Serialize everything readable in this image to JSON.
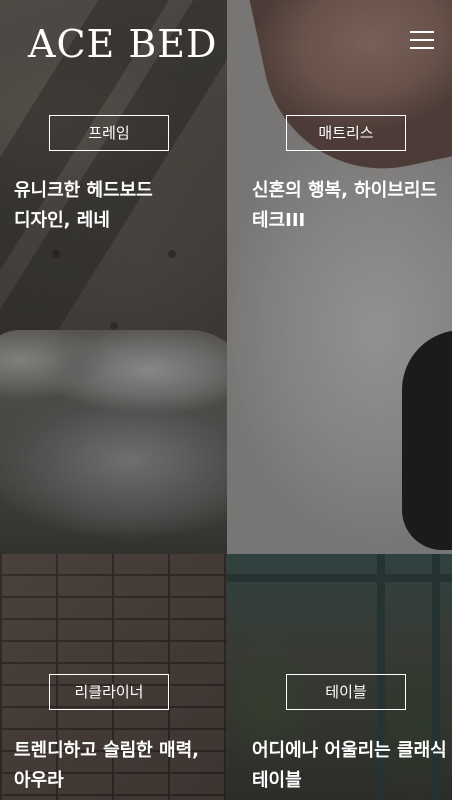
{
  "header": {
    "logo": "ACE BED",
    "menu_icon": "hamburger-menu-icon"
  },
  "panels": [
    {
      "category": "프레임",
      "headline": "유니크한 헤드보드 디자인, 레네"
    },
    {
      "category": "매트리스",
      "headline": "신혼의 행복, 하이브리드 테크III"
    },
    {
      "category": "리클라이너",
      "headline": "트렌디하고 슬림한 매력, 아우라"
    },
    {
      "category": "테이블",
      "headline": "어디에나 어울리는 클래식 테이블"
    }
  ]
}
